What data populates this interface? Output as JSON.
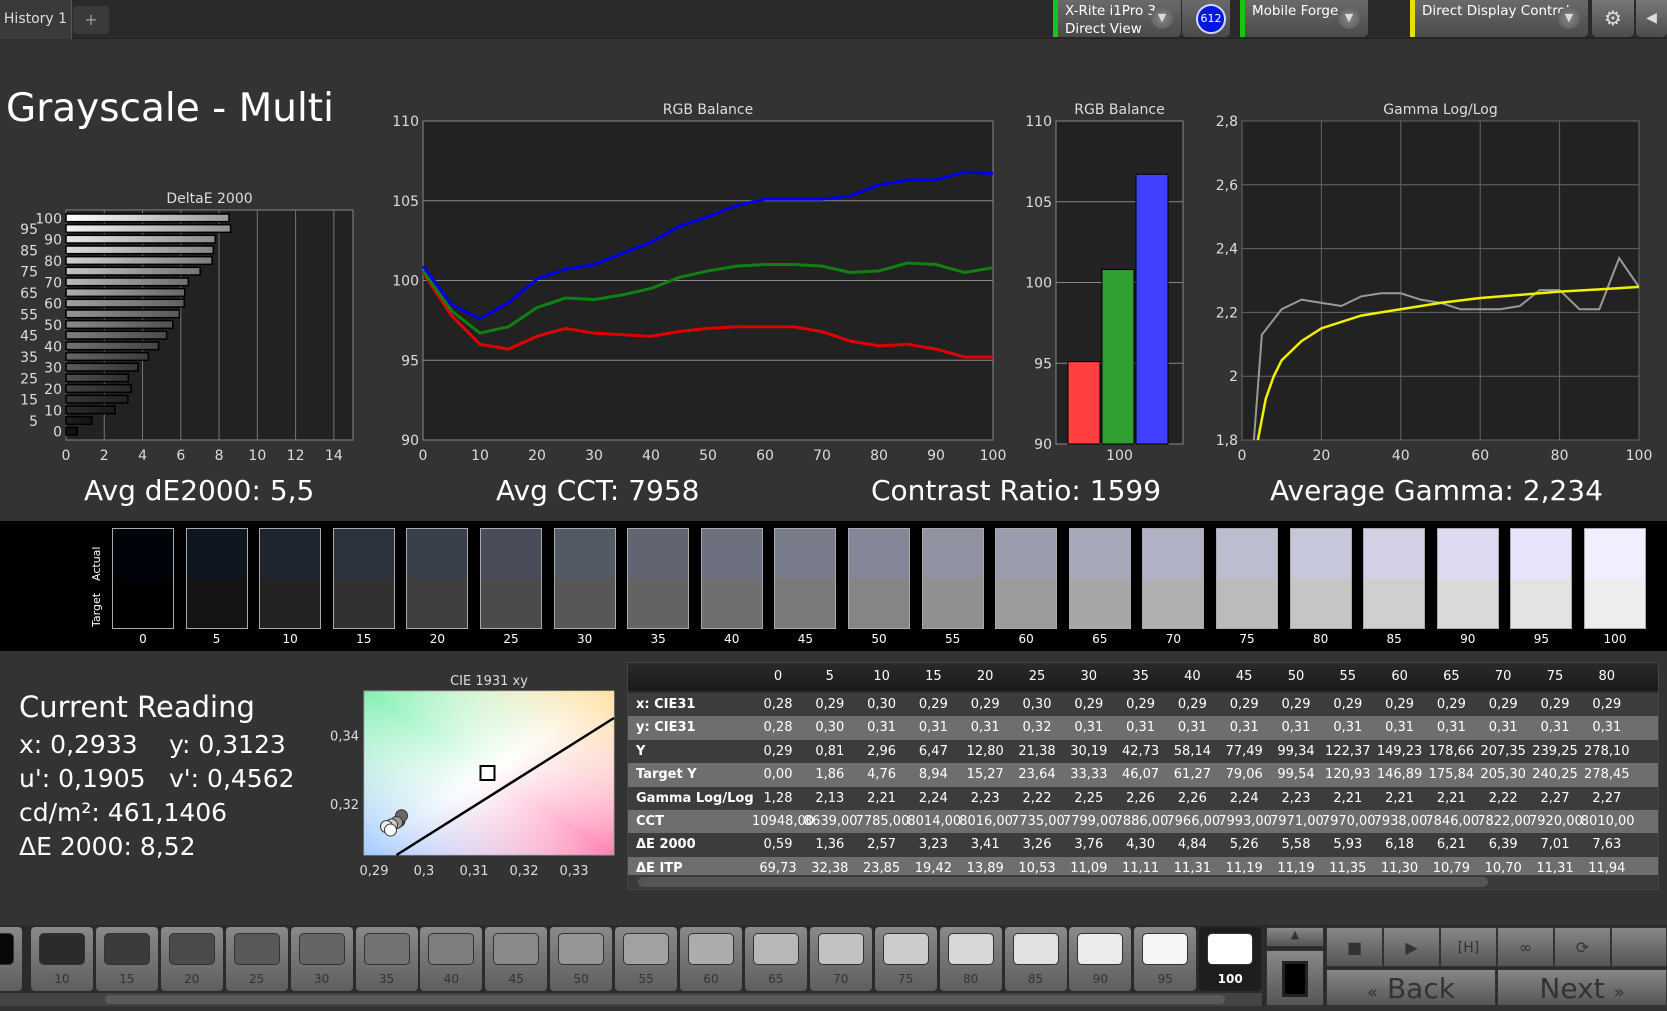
{
  "topbar": {
    "tab": "History 1",
    "add_tab": "+",
    "meter_line1": "X-Rite i1Pro 3",
    "meter_line2": "Direct View",
    "meter_badge": "612",
    "generator": "Mobile Forge",
    "display_control": "Direct Display Control",
    "accent_green": "#19c419",
    "accent_yellow": "#e8e000"
  },
  "title": "Grayscale - Multi",
  "chart_data": [
    {
      "type": "bar",
      "title": "DeltaE 2000",
      "orientation": "horizontal",
      "categories": [
        0,
        5,
        10,
        15,
        20,
        25,
        30,
        35,
        40,
        45,
        50,
        55,
        60,
        65,
        70,
        75,
        80,
        85,
        90,
        95,
        100
      ],
      "values": [
        0.59,
        1.36,
        2.57,
        3.23,
        3.41,
        3.26,
        3.76,
        4.3,
        4.84,
        5.26,
        5.58,
        5.93,
        6.18,
        6.21,
        6.39,
        7.01,
        7.63,
        7.7,
        7.8,
        8.6,
        8.52
      ],
      "xlim": [
        0,
        15
      ],
      "xticks": [
        0,
        2,
        4,
        6,
        8,
        10,
        12,
        14
      ],
      "grid": true
    },
    {
      "type": "line",
      "title": "RGB Balance",
      "x": [
        0,
        5,
        10,
        15,
        20,
        25,
        30,
        35,
        40,
        45,
        50,
        55,
        60,
        65,
        70,
        75,
        80,
        85,
        90,
        95,
        100
      ],
      "ylim": [
        90,
        110
      ],
      "yticks": [
        90,
        95,
        100,
        105,
        110
      ],
      "xticks": [
        0,
        10,
        20,
        30,
        40,
        50,
        60,
        70,
        80,
        90,
        100
      ],
      "grid": true,
      "series": [
        {
          "color": "#e00000",
          "values": [
            100.5,
            97.8,
            96.0,
            95.7,
            96.5,
            97.0,
            96.7,
            96.6,
            96.5,
            96.8,
            97.0,
            97.1,
            97.1,
            97.1,
            96.8,
            96.2,
            95.9,
            96.0,
            95.7,
            95.2,
            95.2
          ]
        },
        {
          "color": "#108010",
          "values": [
            100.6,
            98.1,
            96.7,
            97.1,
            98.3,
            98.9,
            98.8,
            99.1,
            99.5,
            100.2,
            100.6,
            100.9,
            101.0,
            101.0,
            100.9,
            100.5,
            100.6,
            101.1,
            101.0,
            100.5,
            100.8
          ]
        },
        {
          "color": "#0000e8",
          "values": [
            100.9,
            98.5,
            97.6,
            98.6,
            100.1,
            100.7,
            101.0,
            101.7,
            102.4,
            103.4,
            104.0,
            104.7,
            105.1,
            105.1,
            105.1,
            105.3,
            106.0,
            106.3,
            106.3,
            106.8,
            106.7
          ]
        }
      ]
    },
    {
      "type": "bar",
      "title": "RGB Balance",
      "categories": [
        "100"
      ],
      "ylim": [
        90,
        110
      ],
      "yticks": [
        90,
        95,
        100,
        105,
        110
      ],
      "series": [
        {
          "color": "#ff4040",
          "values": [
            95.1
          ]
        },
        {
          "color": "#30a030",
          "values": [
            100.8
          ]
        },
        {
          "color": "#4040ff",
          "values": [
            106.7
          ]
        }
      ]
    },
    {
      "type": "line",
      "title": "Gamma Log/Log",
      "ylim": [
        1.8,
        2.8
      ],
      "yticks": [
        "1,8",
        "2",
        "2,2",
        "2,4",
        "2,6",
        "2,8"
      ],
      "xlim": [
        0,
        100
      ],
      "xticks": [
        0,
        20,
        40,
        60,
        80,
        100
      ],
      "grid": true,
      "series": [
        {
          "color": "#999999",
          "x": [
            3,
            5,
            10,
            15,
            20,
            25,
            30,
            35,
            40,
            45,
            50,
            55,
            60,
            65,
            70,
            75,
            80,
            85,
            90,
            95,
            100
          ],
          "values": [
            1.8,
            2.13,
            2.21,
            2.24,
            2.23,
            2.22,
            2.25,
            2.26,
            2.26,
            2.24,
            2.23,
            2.21,
            2.21,
            2.21,
            2.22,
            2.27,
            2.27,
            2.21,
            2.21,
            2.37,
            2.28
          ]
        },
        {
          "color": "#f0f000",
          "x": [
            4,
            6,
            8,
            10,
            15,
            20,
            30,
            40,
            50,
            60,
            70,
            80,
            90,
            100
          ],
          "values": [
            1.8,
            1.93,
            2.0,
            2.05,
            2.11,
            2.15,
            2.19,
            2.21,
            2.23,
            2.245,
            2.255,
            2.265,
            2.272,
            2.28
          ]
        }
      ]
    },
    {
      "type": "scatter",
      "title": "CIE 1931 xy",
      "xlim": [
        0.288,
        0.338
      ],
      "ylim": [
        0.305,
        0.353
      ],
      "xticks": [
        "0,29",
        "0,3",
        "0,31",
        "0,32",
        "0,33"
      ],
      "yticks": [
        "0,32",
        "0,34"
      ],
      "target": [
        0.3127,
        0.329
      ],
      "points": [
        [
          0.2933,
          0.3123
        ],
        [
          0.2925,
          0.3133
        ],
        [
          0.2935,
          0.3138
        ],
        [
          0.2945,
          0.3145
        ],
        [
          0.2955,
          0.3165
        ],
        [
          0.295,
          0.315
        ]
      ]
    }
  ],
  "summary": {
    "avg_de": "Avg dE2000: 5,5",
    "avg_cct": "Avg CCT: 7958",
    "contrast": "Contrast Ratio: 1599",
    "avg_gamma": "Average Gamma: 2,234"
  },
  "strip": {
    "actual_label": "Actual",
    "target_label": "Target",
    "levels": [
      "0",
      "5",
      "10",
      "15",
      "20",
      "25",
      "30",
      "35",
      "40",
      "45",
      "50",
      "55",
      "60",
      "65",
      "70",
      "75",
      "80",
      "85",
      "90",
      "95",
      "100"
    ]
  },
  "reading": {
    "heading": "Current Reading",
    "x": "x: 0,2933",
    "y": "y: 0,3123",
    "u": "u': 0,1905",
    "v": "v': 0,4562",
    "cd": "cd/m²: 461,1406",
    "de": "ΔE 2000: 8,52"
  },
  "table": {
    "columns": [
      "0",
      "5",
      "10",
      "15",
      "20",
      "25",
      "30",
      "35",
      "40",
      "45",
      "50",
      "55",
      "60",
      "65",
      "70",
      "75",
      "80"
    ],
    "rows": [
      {
        "label": "x: CIE31",
        "values": [
          "0,28",
          "0,29",
          "0,30",
          "0,29",
          "0,29",
          "0,30",
          "0,29",
          "0,29",
          "0,29",
          "0,29",
          "0,29",
          "0,29",
          "0,29",
          "0,29",
          "0,29",
          "0,29",
          "0,29"
        ]
      },
      {
        "label": "y: CIE31",
        "values": [
          "0,28",
          "0,30",
          "0,31",
          "0,31",
          "0,31",
          "0,32",
          "0,31",
          "0,31",
          "0,31",
          "0,31",
          "0,31",
          "0,31",
          "0,31",
          "0,31",
          "0,31",
          "0,31",
          "0,31"
        ]
      },
      {
        "label": "Y",
        "values": [
          "0,29",
          "0,81",
          "2,96",
          "6,47",
          "12,80",
          "21,38",
          "30,19",
          "42,73",
          "58,14",
          "77,49",
          "99,34",
          "122,37",
          "149,23",
          "178,66",
          "207,35",
          "239,25",
          "278,10"
        ]
      },
      {
        "label": "Target Y",
        "values": [
          "0,00",
          "1,86",
          "4,76",
          "8,94",
          "15,27",
          "23,64",
          "33,33",
          "46,07",
          "61,27",
          "79,06",
          "99,54",
          "120,93",
          "146,89",
          "175,84",
          "205,30",
          "240,25",
          "278,45"
        ]
      },
      {
        "label": "Gamma Log/Log",
        "values": [
          "1,28",
          "2,13",
          "2,21",
          "2,24",
          "2,23",
          "2,22",
          "2,25",
          "2,26",
          "2,26",
          "2,24",
          "2,23",
          "2,21",
          "2,21",
          "2,21",
          "2,22",
          "2,27",
          "2,27"
        ]
      },
      {
        "label": "CCT",
        "values": [
          "10948,00",
          "8639,00",
          "7785,00",
          "8014,00",
          "8016,00",
          "7735,00",
          "7799,00",
          "7886,00",
          "7966,00",
          "7993,00",
          "7971,00",
          "7970,00",
          "7938,00",
          "7846,00",
          "7822,00",
          "7920,00",
          "8010,00"
        ]
      },
      {
        "label": "ΔE 2000",
        "values": [
          "0,59",
          "1,36",
          "2,57",
          "3,23",
          "3,41",
          "3,26",
          "3,76",
          "4,30",
          "4,84",
          "5,26",
          "5,58",
          "5,93",
          "6,18",
          "6,21",
          "6,39",
          "7,01",
          "7,63"
        ]
      },
      {
        "label": "ΔE ITP",
        "values": [
          "69,73",
          "32,38",
          "23,85",
          "19,42",
          "13,89",
          "10,53",
          "11,09",
          "11,11",
          "11,31",
          "11,19",
          "11,19",
          "11,35",
          "11,30",
          "10,79",
          "10,70",
          "11,31",
          "11,94"
        ]
      }
    ]
  },
  "bottom": {
    "patches": [
      "10",
      "15",
      "20",
      "25",
      "30",
      "35",
      "40",
      "45",
      "50",
      "55",
      "60",
      "65",
      "70",
      "75",
      "80",
      "85",
      "90",
      "95",
      "100"
    ],
    "selected": "100",
    "back": "Back",
    "next": "Next"
  }
}
